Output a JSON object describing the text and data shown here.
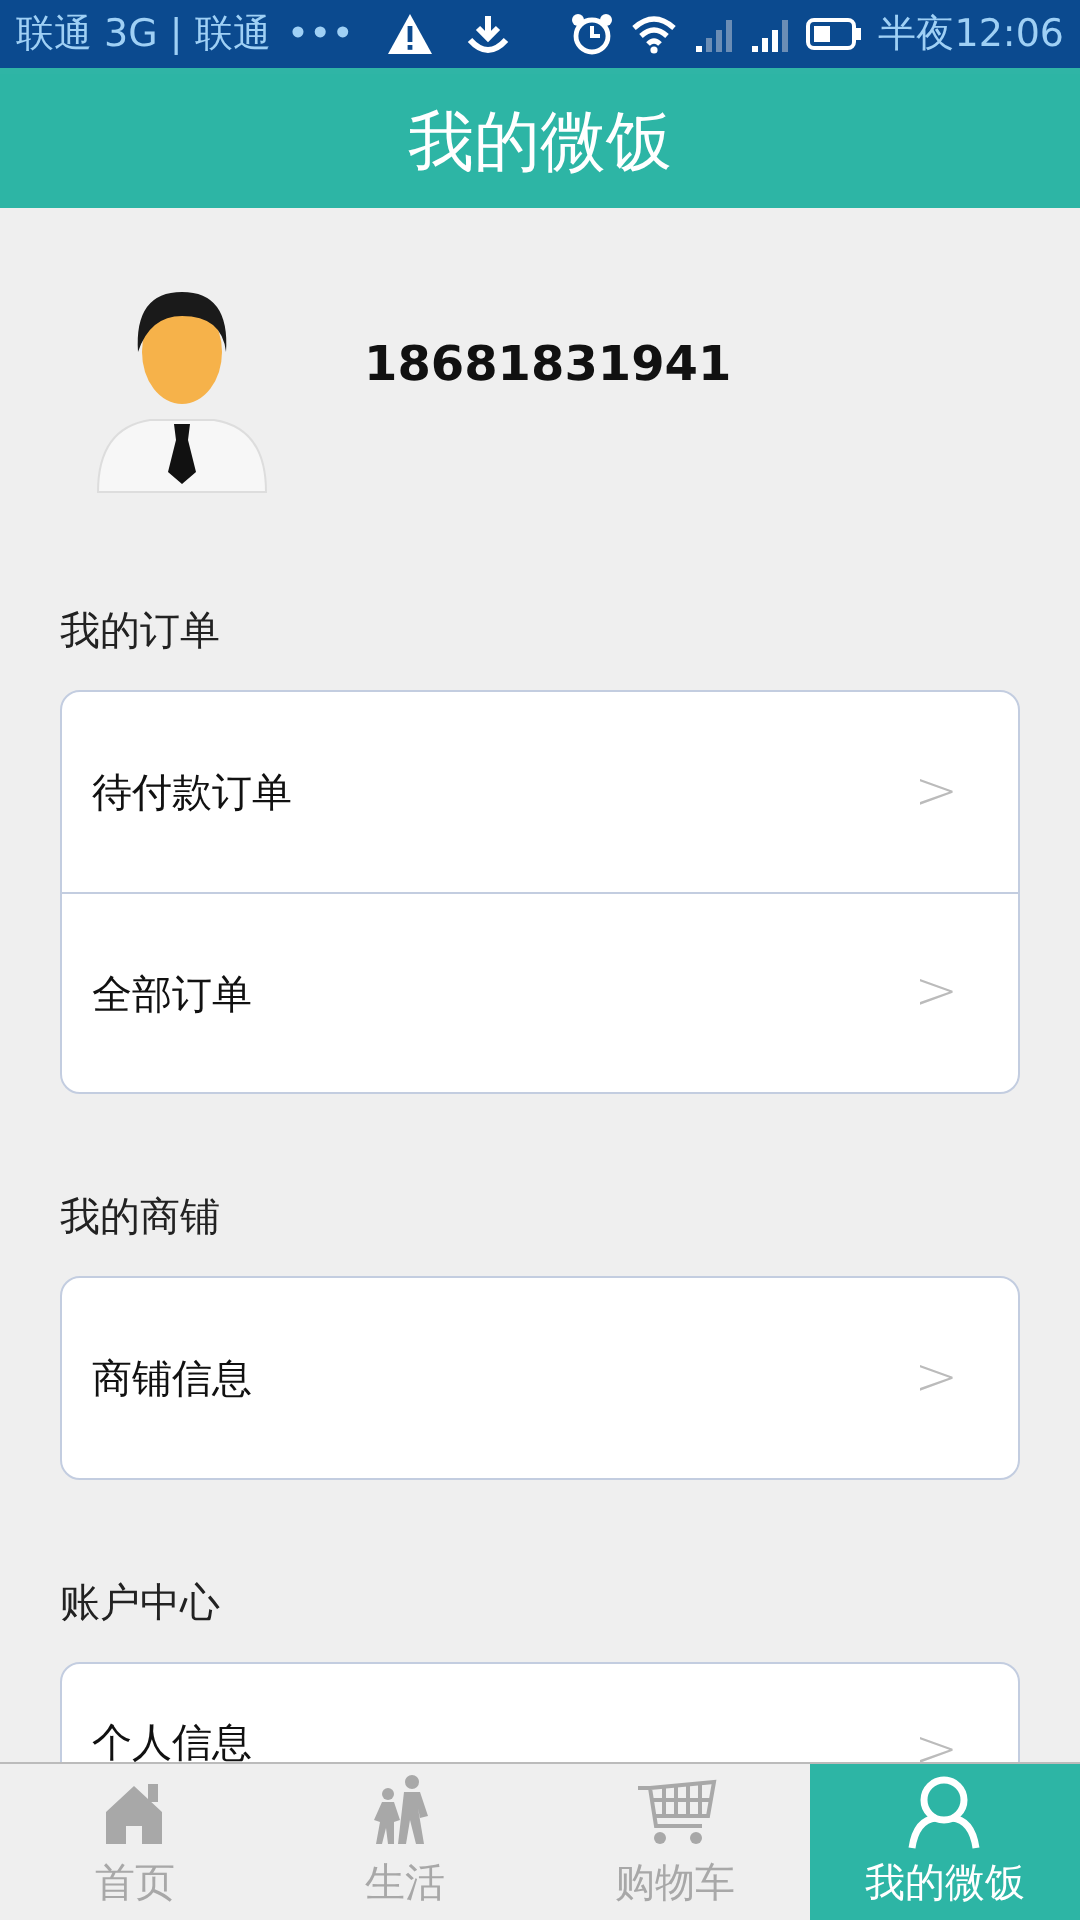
{
  "status_bar": {
    "carrier": "联通 3G | 联通",
    "more": "•••",
    "time": "半夜12:06"
  },
  "header": {
    "title": "我的微饭"
  },
  "profile": {
    "phone": "18681831941"
  },
  "sections": [
    {
      "title": "我的订单",
      "items": [
        {
          "label": "待付款订单",
          "chevron": ">"
        },
        {
          "label": "全部订单",
          "chevron": ">"
        }
      ]
    },
    {
      "title": "我的商铺",
      "items": [
        {
          "label": "商铺信息",
          "chevron": ">"
        }
      ]
    },
    {
      "title": "账户中心",
      "items": [
        {
          "label": "个人信息",
          "chevron": ">"
        }
      ]
    }
  ],
  "tabs": [
    {
      "label": "首页",
      "selected": false
    },
    {
      "label": "生活",
      "selected": false
    },
    {
      "label": "购物车",
      "selected": false
    },
    {
      "label": "我的微饭",
      "selected": true
    }
  ]
}
